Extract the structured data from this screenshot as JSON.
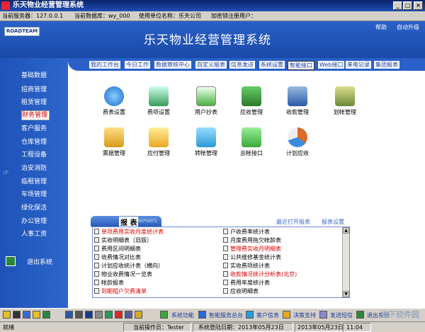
{
  "window": {
    "title": "乐天物业经营管理系统",
    "min": "_",
    "max": "□",
    "close": "×"
  },
  "infobar": {
    "server": "当前服务器：127.0.0.1",
    "database": "当前数据库：wy_000",
    "company": "使用单位名称：乐天公司",
    "lock": "加密锁注册用户："
  },
  "header": {
    "logo": "ROADTEAM",
    "system_title": "乐天物业经营管理系统",
    "help": "帮助",
    "autoupgrade": "自动升级"
  },
  "sidebar": {
    "items": [
      "基础数据",
      "招商管理",
      "租赁管理",
      "财务管理",
      "客户服务",
      "仓库管理",
      "工程设备",
      "治安消防",
      "临租管理",
      "车场管理",
      "绿化保洁",
      "办公管理",
      "人事工资"
    ],
    "active": "财务管理",
    "exit": "退出系统"
  },
  "navbar": [
    "我的工作台",
    "今日工作",
    "数据审核中心",
    "自定义报表",
    "信息发送",
    "系统设置",
    "智能接口",
    "Web接口",
    "来电记录",
    "集团报表"
  ],
  "functions": [
    {
      "label": "费表设置",
      "icon": "clock-icon",
      "color": "#2a7ad8"
    },
    {
      "label": "费项设置",
      "icon": "fee-settings-icon",
      "color": "#3a9a5a"
    },
    {
      "label": "用户抄表",
      "icon": "meter-reading-icon",
      "color": "#4ab040"
    },
    {
      "label": "应收管理",
      "icon": "receivable-icon",
      "color": "#3a9a3a"
    },
    {
      "label": "收款管理",
      "icon": "payment-icon",
      "color": "#2a5aa8"
    },
    {
      "label": "划帐管理",
      "icon": "transfer-icon",
      "color": "#6a8a3a"
    },
    {
      "label": "票据管理",
      "icon": "receipt-icon",
      "color": "#d89a1a"
    },
    {
      "label": "应付管理",
      "icon": "payable-icon",
      "color": "#e8a820"
    },
    {
      "label": "转帐管理",
      "icon": "transfer-account-icon",
      "color": "#2a9ad8"
    },
    {
      "label": "总帐接口",
      "icon": "ledger-icon",
      "color": "#3aa83a"
    },
    {
      "label": "计划应收",
      "icon": "plan-receivable-icon",
      "color": "#d86a2a"
    }
  ],
  "report": {
    "title": "报 表",
    "subtitle": "REPORTS",
    "recent": "最近打开报表",
    "settings": "报表设置",
    "left": [
      {
        "text": "单项费用实收月度统计表",
        "red": true
      },
      {
        "text": "实收明细表（旧版）",
        "red": false
      },
      {
        "text": "费用区间明细表",
        "red": false
      },
      {
        "text": "收费情况对比表",
        "red": false
      },
      {
        "text": "计划应收统计表（横向）",
        "red": false
      },
      {
        "text": "物业收费情况一览表",
        "red": false
      },
      {
        "text": "帐龄报表",
        "red": false
      },
      {
        "text": "到期租户欠费清单",
        "red": true
      }
    ],
    "right": [
      {
        "text": "户收费率统计表",
        "red": false
      },
      {
        "text": "月度费用拖欠帐龄表",
        "red": false
      },
      {
        "text": "管理费实收月明细表",
        "red": true
      },
      {
        "text": "公共维修基金统计表",
        "red": false
      },
      {
        "text": "实收费项统计表",
        "red": false
      },
      {
        "text": "收款情况统计分析表(北京)",
        "red": true
      },
      {
        "text": "费用年度统计表",
        "red": false
      },
      {
        "text": "应收明细表",
        "red": false
      }
    ]
  },
  "toolbar": {
    "system_functions": "系统功能",
    "smart_service": "智能服务总台",
    "customer_info": "客户信息",
    "decision_support": "决策支持",
    "send_short": "发送短信",
    "exit": "退出系统"
  },
  "status": {
    "ready": "就绪",
    "operator": "当前操作员：Tester",
    "login_date": "系统登陆日期：2013年05月23日",
    "today": "2013年05月23日",
    "time": "11:04"
  },
  "watermark": "当下软件园"
}
